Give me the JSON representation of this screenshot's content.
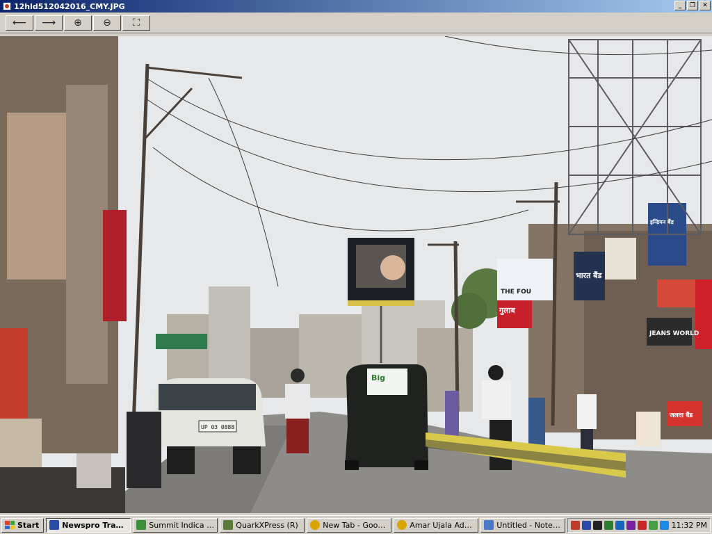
{
  "window": {
    "title": "12hld512042016_CMY.JPG",
    "controls": [
      "_",
      "❐",
      "✕"
    ]
  },
  "toolbar": {
    "buttons": [
      {
        "name": "previous-image",
        "glyph": "⟵"
      },
      {
        "name": "next-image",
        "glyph": "⟶"
      },
      {
        "name": "zoom-in",
        "glyph": "⊕"
      },
      {
        "name": "zoom-out",
        "glyph": "⊖"
      },
      {
        "name": "best-fit",
        "glyph": "⛶"
      }
    ]
  },
  "photo": {
    "signs": {
      "sign_bhaarat": "भारत बैंड",
      "sign_gulab": "गुलाब",
      "sign_jeans": "JEANS WORLD",
      "sign_jalvaa": "जलवा बैंड",
      "sign_big": "Big",
      "sign_four": "THE FOU",
      "plate_car": "UP 03 0888",
      "sign_india": "इन्डियन बैंड"
    }
  },
  "taskbar": {
    "start_label": "Start",
    "tasks": [
      {
        "label": "Newspro Track...",
        "color": "#2b4aa8",
        "active": true
      },
      {
        "label": "Summit Indica Un...",
        "color": "#3a8f3a",
        "active": false
      },
      {
        "label": "QuarkXPress (R)",
        "color": "#5a7a3a",
        "active": false
      },
      {
        "label": "New Tab - Googl...",
        "color": "#d9a400",
        "active": false
      },
      {
        "label": "Amar Ujala Admi...",
        "color": "#d9a400",
        "active": false
      },
      {
        "label": "Untitled - Notepad",
        "color": "#4a78c8",
        "active": false
      }
    ],
    "tray_icons": [
      "#c0392b",
      "#2b4aa8",
      "#222",
      "#2e7d32",
      "#1565c0",
      "#7b1fa2",
      "#c62828",
      "#43a047",
      "#1e88e5",
      "#333",
      "#2e7d32"
    ],
    "clock": "11:32 PM"
  },
  "colors": {
    "titlebar_start": "#0a246a",
    "titlebar_end": "#a6caf0",
    "chrome": "#d4d0c8"
  }
}
